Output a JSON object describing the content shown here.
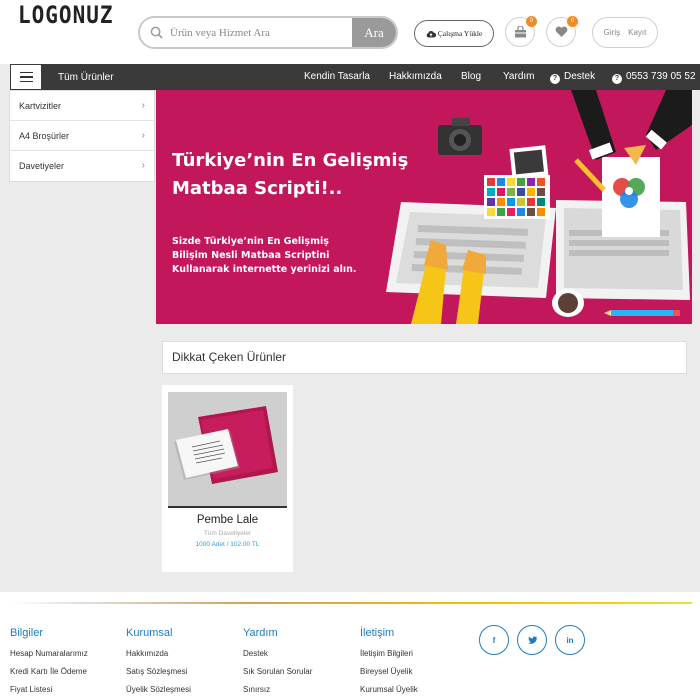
{
  "header": {
    "logo": "LOGONUZ",
    "search_placeholder": "Ürün veya Hizmet Ara",
    "search_button": "Ara",
    "upload_label": "Çalışma Yükle",
    "cart_count": "0",
    "favorites_count": "0",
    "login_label": "Giriş",
    "register_label": "Kayıt"
  },
  "nav": {
    "all_products": "Tüm Ürünler",
    "links": [
      "Kendin Tasarla",
      "Hakkımızda",
      "Blog",
      "Yardım"
    ],
    "support_label": "Destek",
    "phone": "0553 739 05 52"
  },
  "categories": [
    "Kartvizitler",
    "A4 Broşürler",
    "Davetiyeler"
  ],
  "banner": {
    "title_line1": "Türkiye’nin En Gelişmiş",
    "title_line2": "Matbaa Scripti!..",
    "sub_line1": "Sizde Türkiye’nin En Gelişmiş",
    "sub_line2": "Bilişim Nesli Matbaa Scriptini",
    "sub_line3": "Kullanarak internette yerinizi alın.",
    "background_color": "#c2185b"
  },
  "featured": {
    "heading": "Dikkat Çeken Ürünler",
    "products": [
      {
        "name": "Pembe Lale",
        "category": "Tüm Davetiyeler",
        "price": "1000 Adet / 102.00 TL"
      }
    ]
  },
  "footer": {
    "columns": [
      {
        "title": "Bilgiler",
        "links": [
          "Hesap Numaralarımız",
          "Kredi Kartı İle Ödeme",
          "Fiyat Listesi"
        ]
      },
      {
        "title": "Kurumsal",
        "links": [
          "Hakkımızda",
          "Satış Sözleşmesi",
          "Üyelik Sözleşmesi"
        ]
      },
      {
        "title": "Yardım",
        "links": [
          "Destek",
          "Sık Sorulan Sorular",
          "Sınırsız"
        ]
      },
      {
        "title": "İletişim",
        "links": [
          "İletişim Bilgileri",
          "Bireysel Üyelik",
          "Kurumsal Üyelik"
        ]
      }
    ],
    "social": [
      "f",
      "t",
      "in"
    ],
    "social_icons": [
      "facebook-icon",
      "twitter-icon",
      "linkedin-icon"
    ],
    "accent_color": "#1e7cc2"
  }
}
